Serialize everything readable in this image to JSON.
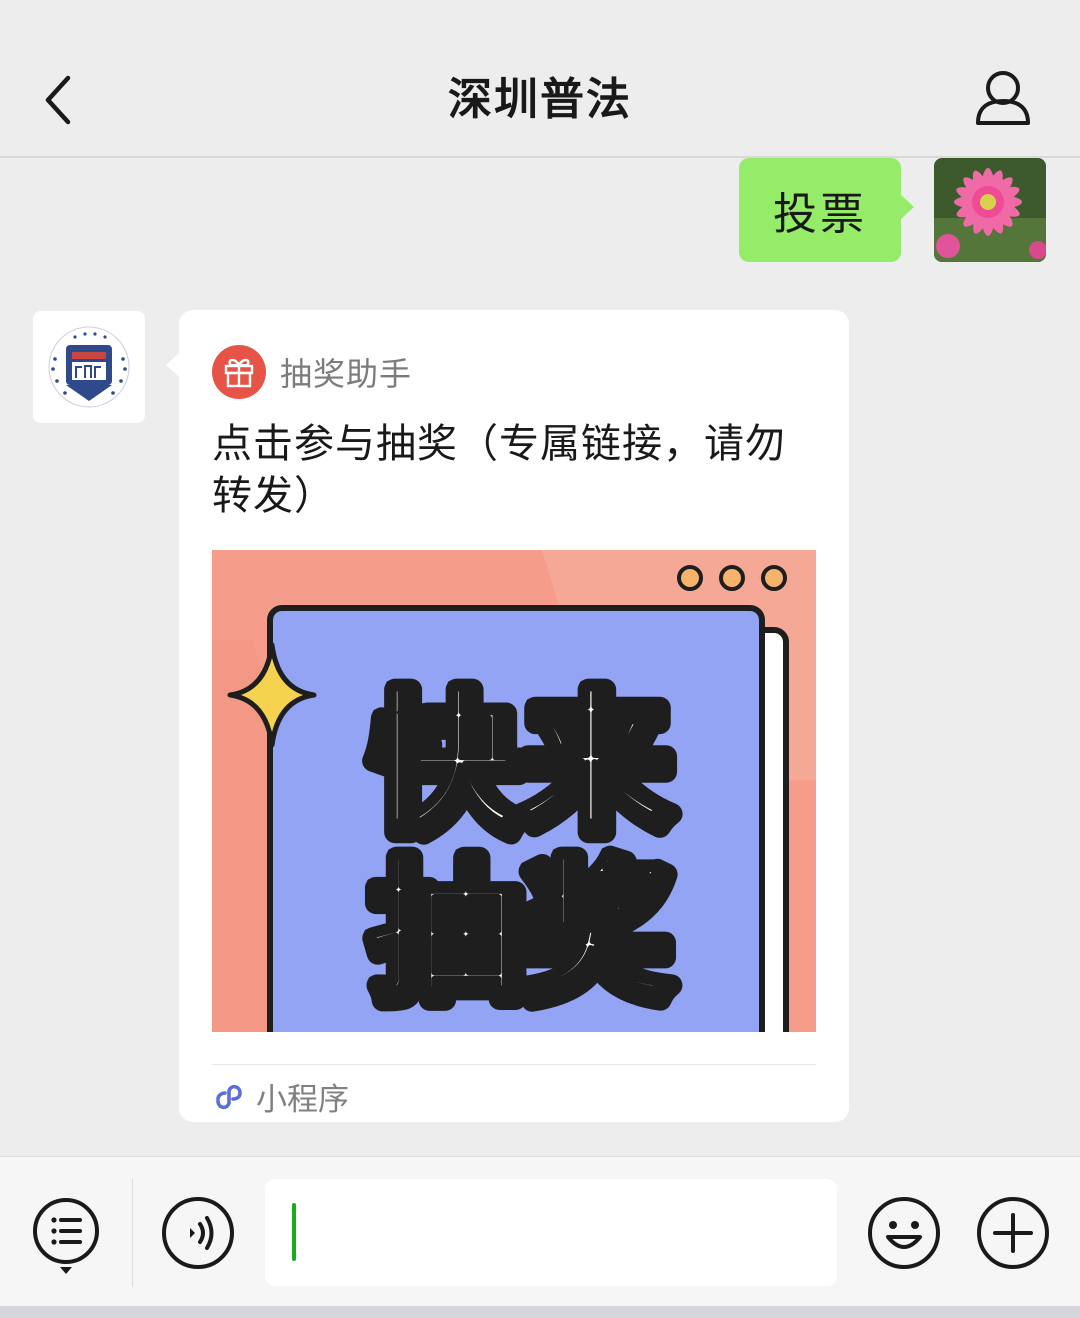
{
  "header": {
    "title": "深圳普法"
  },
  "messages": {
    "outgoing_text": "投票",
    "card": {
      "mini_program_name": "抽奖助手",
      "description": "点击参与抽奖（专属链接，请勿转发）",
      "image_headline_line1": "快来",
      "image_headline_line2": "抽奖",
      "footer_label": "小程序"
    }
  },
  "colors": {
    "outgoing_bubble": "#95ec69",
    "card_image_bg": "#f59d8a",
    "card_panel": "#93a4f5",
    "gift_badge": "#e55447",
    "caret": "#1aad19"
  },
  "icons": {
    "back": "chevron-left-icon",
    "profile": "person-icon",
    "gift": "gift-icon",
    "mini_program": "mini-program-icon",
    "menu": "menu-list-icon",
    "voice": "voice-icon",
    "emoji": "emoji-icon",
    "plus": "plus-icon"
  }
}
